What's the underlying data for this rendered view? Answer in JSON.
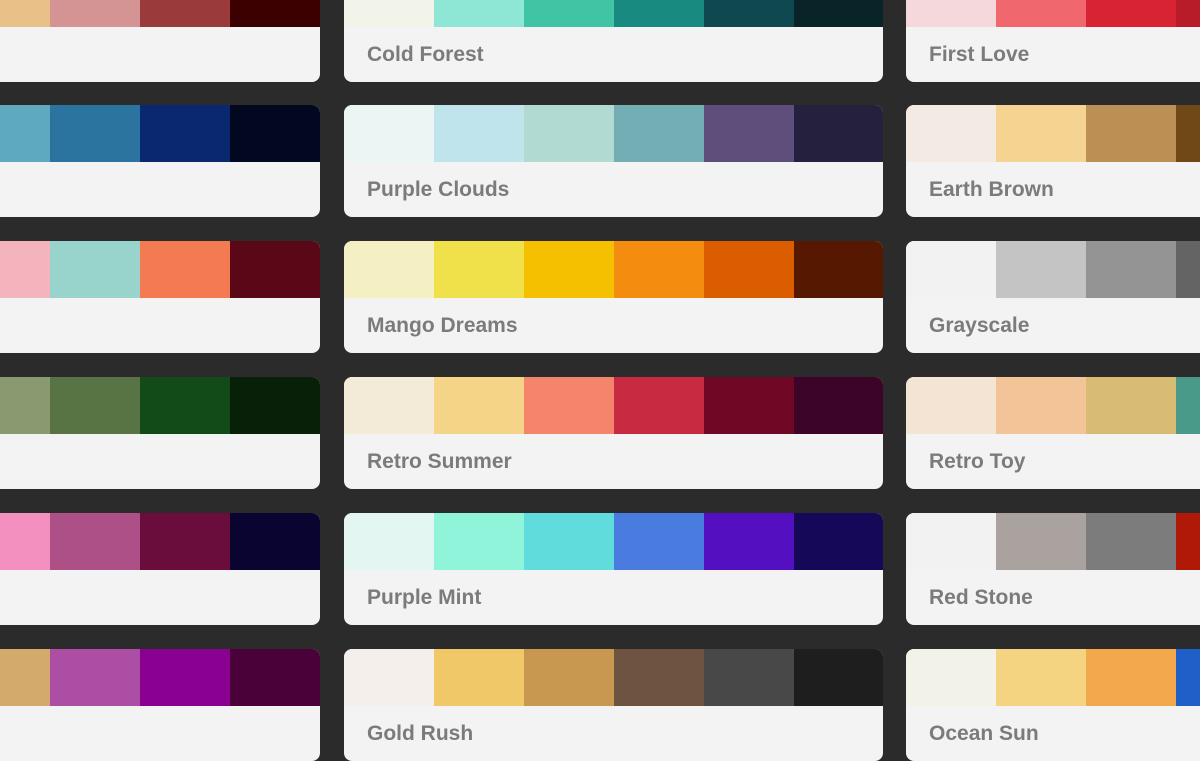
{
  "columns": [
    {
      "cards": [
        {
          "name": "",
          "colors": [
            "#e8c088",
            "#d49494",
            "#9a3a3a",
            "#3c0000"
          ]
        },
        {
          "name": "",
          "colors": [
            "#5ea8c0",
            "#2c74a0",
            "#0a2870",
            "#020820"
          ]
        },
        {
          "name": "",
          "colors": [
            "#f4b4be",
            "#98d4cc",
            "#f47a52",
            "#5a0818"
          ]
        },
        {
          "name": "",
          "colors": [
            "#8a9a70",
            "#587444",
            "#124a18",
            "#082008"
          ]
        },
        {
          "name": "",
          "colors": [
            "#f490c0",
            "#ae5088",
            "#6a0c3c",
            "#0a0430"
          ]
        },
        {
          "name": "",
          "colors": [
            "#d4aa6c",
            "#ac4ea4",
            "#8a0090",
            "#4a0038"
          ]
        }
      ]
    },
    {
      "cards": [
        {
          "name": "Cold Forest",
          "colors": [
            "#f2f4ea",
            "#8ee6d4",
            "#40c4a4",
            "#188a80",
            "#104850",
            "#082428"
          ]
        },
        {
          "name": "Purple Clouds",
          "colors": [
            "#eaf5f4",
            "#c0e4ec",
            "#b0dad2",
            "#72aeb4",
            "#5e4e7c",
            "#24203e"
          ]
        },
        {
          "name": "Mango Dreams",
          "colors": [
            "#f4f0c4",
            "#f0e04a",
            "#f4c000",
            "#f48c10",
            "#dc5c00",
            "#561800"
          ]
        },
        {
          "name": "Retro Summer",
          "colors": [
            "#f4ead8",
            "#f4d486",
            "#f4846a",
            "#c82a42",
            "#6e0824",
            "#3c0428"
          ]
        },
        {
          "name": "Purple Mint",
          "colors": [
            "#e4f6f2",
            "#90f4da",
            "#60dcdc",
            "#4a7ce0",
            "#5410c0",
            "#160858"
          ]
        },
        {
          "name": "Gold Rush",
          "colors": [
            "#f5efec",
            "#f0c868",
            "#c89850",
            "#6e5440",
            "#484848",
            "#1e1e1e"
          ]
        }
      ]
    },
    {
      "cards": [
        {
          "name": "First Love",
          "colors": [
            "#f4d8dc",
            "#f0686e",
            "#d82432",
            "#b81c28"
          ]
        },
        {
          "name": "Earth Brown",
          "colors": [
            "#f4eae4",
            "#f4d490",
            "#bc9054",
            "#704818"
          ]
        },
        {
          "name": "Grayscale",
          "colors": [
            "#f2f2f2",
            "#c4c4c4",
            "#949494",
            "#646464"
          ]
        },
        {
          "name": "Retro Toy",
          "colors": [
            "#f4e4d4",
            "#f2c498",
            "#d8bc74",
            "#4a9a8a"
          ]
        },
        {
          "name": "Red Stone",
          "colors": [
            "#f2f2f2",
            "#aaa29e",
            "#7c7c7c",
            "#b01808"
          ]
        },
        {
          "name": "Ocean Sun",
          "colors": [
            "#f2f2e8",
            "#f4d480",
            "#f4a84c",
            "#1e60c8"
          ]
        }
      ]
    }
  ]
}
